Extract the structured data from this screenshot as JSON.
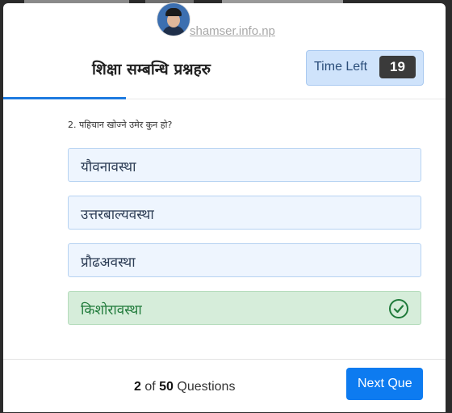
{
  "site": {
    "link_text": "shamser.info.np"
  },
  "header": {
    "title": "शिक्षा सम्बन्धि प्रश्नहरु",
    "timer_label": "Time Left",
    "timer_value": "19"
  },
  "question": {
    "text": "2. पहिचान खोज्ने उमेर कुन हो?",
    "options": [
      {
        "label": "यौवनावस्था",
        "state": "default"
      },
      {
        "label": "उत्तरबाल्यवस्था",
        "state": "default"
      },
      {
        "label": "प्रौढअवस्था",
        "state": "default"
      },
      {
        "label": "किशोरावस्था",
        "state": "correct"
      }
    ]
  },
  "footer": {
    "current": "2",
    "of_text": "of",
    "total": "50",
    "questions_text": "Questions",
    "next_label": "Next Que"
  },
  "colors": {
    "accent": "#0d7bf0",
    "correct": "#1f7a3a",
    "option_bg": "#eef5fe"
  }
}
